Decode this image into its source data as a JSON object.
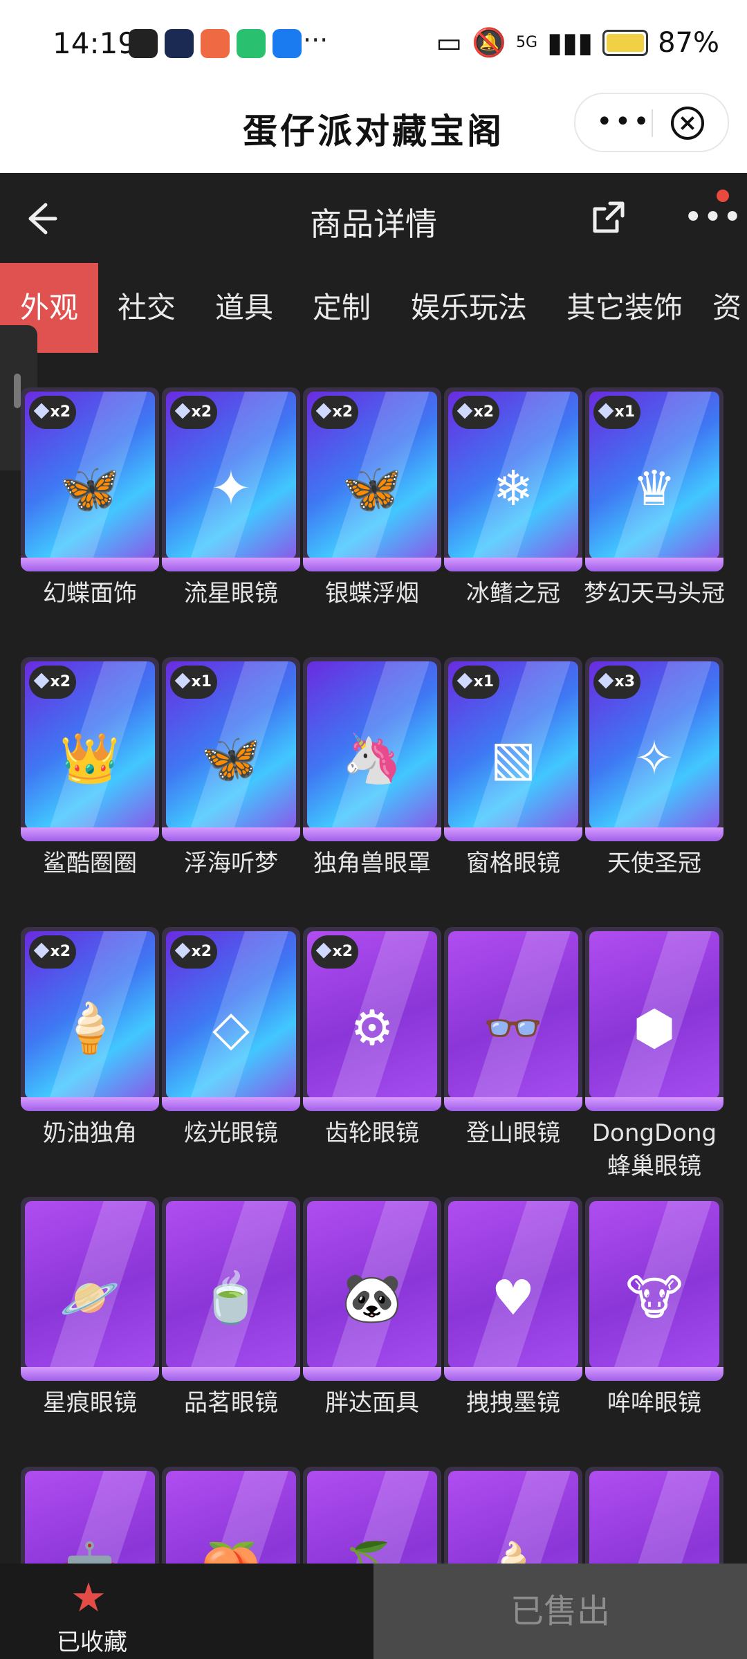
{
  "status_bar": {
    "time": "14:19",
    "dots": "···",
    "network": "5G",
    "battery": "87%"
  },
  "miniapp": {
    "title": "蛋仔派对藏宝阁"
  },
  "nav": {
    "title": "商品详情"
  },
  "tabs": [
    "外观",
    "社交",
    "道具",
    "定制",
    "娱乐玩法",
    "其它装饰",
    "资"
  ],
  "items": [
    {
      "name": "幻蝶面饰",
      "badge": "x2",
      "style": "blue",
      "icon": "🦋"
    },
    {
      "name": "流星眼镜",
      "badge": "x2",
      "style": "blue",
      "icon": "✦"
    },
    {
      "name": "银蝶浮烟",
      "badge": "x2",
      "style": "blue",
      "icon": "🦋"
    },
    {
      "name": "冰鳍之冠",
      "badge": "x2",
      "style": "blue",
      "icon": "❄"
    },
    {
      "name": "梦幻天马头冠",
      "badge": "x1",
      "style": "blue",
      "icon": "♛"
    },
    {
      "name": "鲨酷圈圈",
      "badge": "x2",
      "style": "blue",
      "icon": "👑"
    },
    {
      "name": "浮海听梦",
      "badge": "x1",
      "style": "blue",
      "icon": "🦋"
    },
    {
      "name": "独角兽眼罩",
      "badge": "",
      "style": "blue",
      "icon": "🦄"
    },
    {
      "name": "窗格眼镜",
      "badge": "x1",
      "style": "blue",
      "icon": "▧"
    },
    {
      "name": "天使圣冠",
      "badge": "x3",
      "style": "blue",
      "icon": "✧"
    },
    {
      "name": "奶油独角",
      "badge": "x2",
      "style": "blue",
      "icon": "🍦"
    },
    {
      "name": "炫光眼镜",
      "badge": "x2",
      "style": "blue",
      "icon": "◇"
    },
    {
      "name": "齿轮眼镜",
      "badge": "x2",
      "style": "purple",
      "icon": "⚙"
    },
    {
      "name": "登山眼镜",
      "badge": "",
      "style": "purple",
      "icon": "👓"
    },
    {
      "name": "DongDong蜂巢眼镜",
      "badge": "",
      "style": "purple",
      "icon": "⬢"
    },
    {
      "name": "星痕眼镜",
      "badge": "",
      "style": "purple",
      "icon": "🪐"
    },
    {
      "name": "品茗眼镜",
      "badge": "",
      "style": "purple",
      "icon": "🍵"
    },
    {
      "name": "胖达面具",
      "badge": "",
      "style": "purple",
      "icon": "🐼"
    },
    {
      "name": "拽拽墨镜",
      "badge": "",
      "style": "purple",
      "icon": "♥"
    },
    {
      "name": "哞哞眼镜",
      "badge": "",
      "style": "purple",
      "icon": "🐮"
    },
    {
      "name": "",
      "badge": "",
      "style": "purple",
      "icon": "🤖"
    },
    {
      "name": "",
      "badge": "",
      "style": "purple",
      "icon": "🍑"
    },
    {
      "name": "",
      "badge": "",
      "style": "purple",
      "icon": "🍒"
    },
    {
      "name": "",
      "badge": "",
      "style": "purple",
      "icon": "🍦"
    },
    {
      "name": "",
      "badge": "",
      "style": "purple",
      "icon": "☁"
    }
  ],
  "bottom": {
    "favorite_label": "已收藏",
    "sold_label": "已售出"
  },
  "colors": {
    "accent": "#e0524f",
    "page_bg": "#1f1f1f",
    "sold_bg": "#4a4a4a"
  }
}
